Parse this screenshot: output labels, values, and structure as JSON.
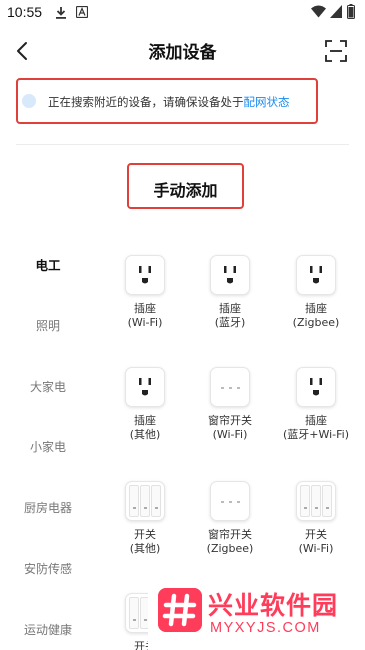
{
  "status_bar": {
    "time": "10:55",
    "icons": [
      "download-icon",
      "app-a-icon",
      "wifi-icon",
      "signal-icon",
      "battery-icon"
    ]
  },
  "header": {
    "title": "添加设备",
    "back_icon": "back-icon",
    "scan_icon": "scan-icon"
  },
  "search": {
    "text": "正在搜索附近的设备，请确保设备处于",
    "link": "配网状态"
  },
  "manual": {
    "title": "手动添加"
  },
  "categories": [
    "电工",
    "照明",
    "大家电",
    "小家电",
    "厨房电器",
    "安防传感",
    "运动健康"
  ],
  "active_category": "电工",
  "devices": [
    {
      "name": "插座",
      "sub": "(Wi-Fi)",
      "icon": "socket-icon"
    },
    {
      "name": "插座",
      "sub": "(蓝牙)",
      "icon": "socket-icon"
    },
    {
      "name": "插座",
      "sub": "(Zigbee)",
      "icon": "socket-icon"
    },
    {
      "name": "插座",
      "sub": "(其他)",
      "icon": "socket-icon"
    },
    {
      "name": "窗帘开关",
      "sub": "(Wi-Fi)",
      "icon": "curtain-switch-icon"
    },
    {
      "name": "插座",
      "sub": "(蓝牙+Wi-Fi)",
      "icon": "socket-icon"
    },
    {
      "name": "开关",
      "sub": "(其他)",
      "icon": "three-gang-switch-icon"
    },
    {
      "name": "窗帘开关",
      "sub": "(Zigbee)",
      "icon": "curtain-switch-icon"
    },
    {
      "name": "开关",
      "sub": "(Wi-Fi)",
      "icon": "three-gang-switch-icon"
    },
    {
      "name": "开关",
      "sub": "",
      "icon": "three-gang-switch-icon"
    }
  ],
  "watermark": {
    "title": "兴业软件园",
    "subtitle": "MYXYJS.COM"
  },
  "colors": {
    "highlight_border": "#e0403a",
    "link": "#1a8cf0",
    "watermark": "#ff3c5a"
  }
}
